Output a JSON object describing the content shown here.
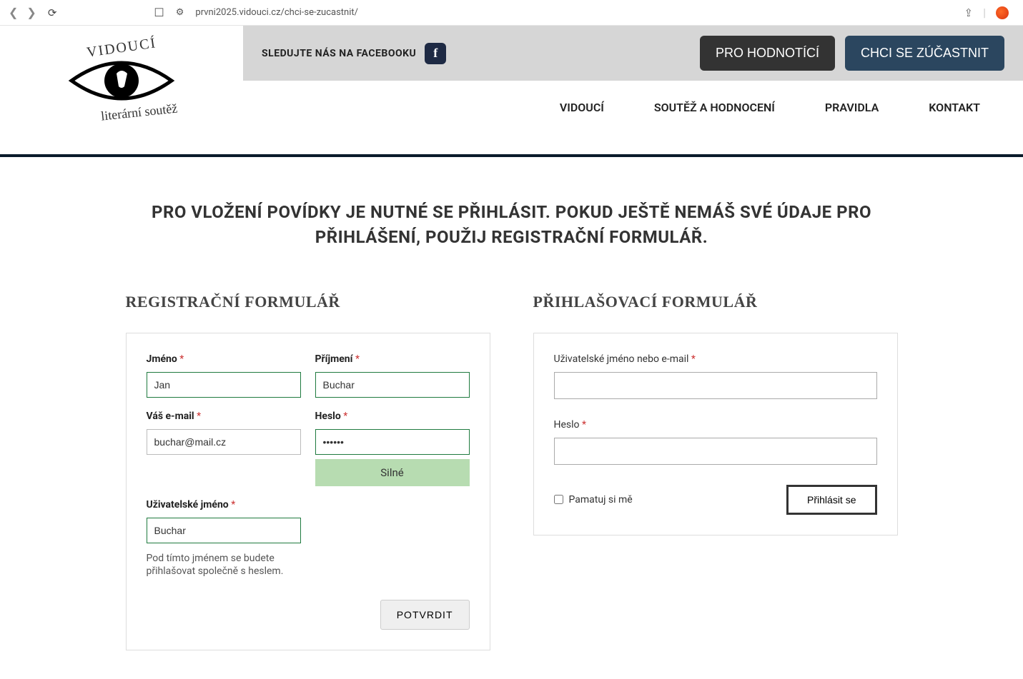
{
  "browser": {
    "url": "prvni2025.vidouci.cz/chci-se-zucastnit/"
  },
  "logo": {
    "top": "VIDOUCÍ",
    "sub": "literární soutěž"
  },
  "topbar": {
    "follow_text": "SLEDUJTE NÁS NA FACEBOOKU",
    "fb_glyph": "f",
    "btn_evaluators": "PRO HODNOTÍCÍ",
    "btn_participate": "CHCI SE ZÚČASTNIT"
  },
  "nav": {
    "home": "VIDOUCÍ",
    "contest": "SOUTĚŽ A HODNOCENÍ",
    "rules": "PRAVIDLA",
    "contact": "KONTAKT"
  },
  "heading": "PRO VLOŽENÍ POVÍDKY JE NUTNÉ SE PŘIHLÁSIT. POKUD JEŠTĚ NEMÁŠ SVÉ ÚDAJE PRO PŘIHLÁŠENÍ, POUŽIJ REGISTRAČNÍ FORMULÁŘ.",
  "registration": {
    "title": "REGISTRAČNÍ FORMULÁŘ",
    "first_name_label": "Jméno",
    "first_name_value": "Jan",
    "last_name_label": "Příjmení",
    "last_name_value": "Buchar",
    "email_label": "Váš e-mail",
    "email_value": "buchar@mail.cz",
    "password_label": "Heslo",
    "password_value": "••••••",
    "strength_label": "Silné",
    "username_label": "Uživatelské jméno",
    "username_value": "Buchar",
    "username_hint": "Pod tímto jménem se budete přihlašovat společně s heslem.",
    "submit_label": "POTVRDIT",
    "star": "*"
  },
  "login": {
    "title": "PŘIHLAŠOVACÍ FORMULÁŘ",
    "user_label": "Uživatelské jméno nebo e-mail",
    "user_value": "",
    "password_label": "Heslo",
    "password_value": "",
    "remember_label": "Pamatuj si mě",
    "submit_label": "Přihlásit se",
    "star": "*"
  }
}
